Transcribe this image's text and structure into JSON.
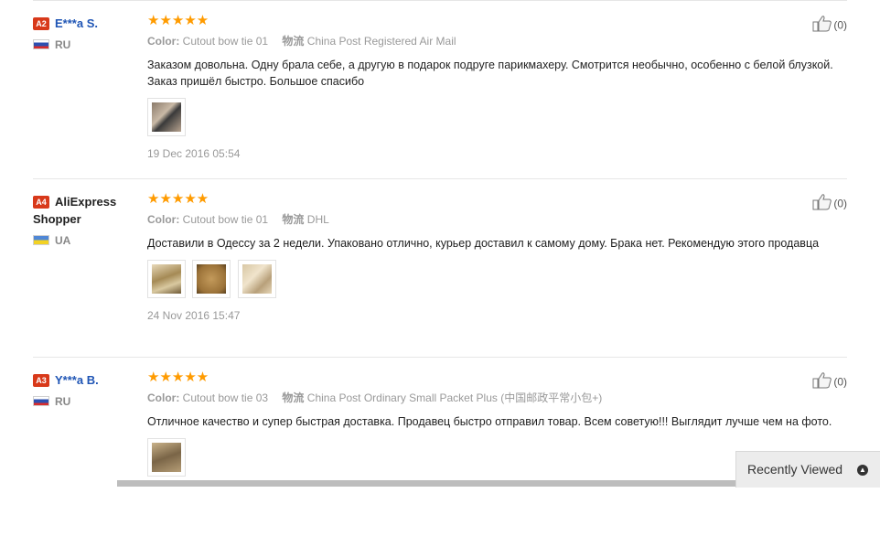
{
  "reviews": [
    {
      "level": "A2",
      "user_lines": [
        "E***a S."
      ],
      "country": "RU",
      "stars": "★★★★★",
      "color_label": "Color:",
      "color_value": "Cutout bow tie 01",
      "shipping_label": "物流",
      "shipping_value": "China Post Registered Air Mail",
      "text": "Заказом довольна. Одну брала себе, а другую в подарок подруге парикмахеру. Смотрится необычно, особенно с белой блузкой. Заказ пришёл быстро. Большое спасибо",
      "date": "19 Dec 2016 05:54",
      "likes": "(0)"
    },
    {
      "level": "A4",
      "user_lines": [
        "AliExpress",
        "Shopper"
      ],
      "country": "UA",
      "stars": "★★★★★",
      "color_label": "Color:",
      "color_value": "Cutout bow tie 01",
      "shipping_label": "物流",
      "shipping_value": "DHL",
      "text": "Доставили в Одессу за 2 недели. Упаковано отлично, курьер доставил к самому дому. Брака нет. Рекомендую этого продавца",
      "date": "24 Nov 2016 15:47",
      "likes": "(0)"
    },
    {
      "level": "A3",
      "user_lines": [
        "Y***a B."
      ],
      "country": "RU",
      "stars": "★★★★★",
      "color_label": "Color:",
      "color_value": "Cutout bow tie 03",
      "shipping_label": "物流",
      "shipping_value": "China Post Ordinary Small Packet Plus (中国邮政平常小包+)",
      "text": "Отличное качество и супер быстрая доставка. Продавец быстро отправил товар. Всем советую!!! Выглядит лучше чем на фото.",
      "likes": "(0)"
    }
  ],
  "recently_viewed": "Recently Viewed",
  "colors": {
    "star": "#ff9b00",
    "username": "#1f55b5",
    "badge": "#d8391a"
  },
  "icons": {
    "like": "thumbs-up-icon",
    "recent": "chevron-up-icon"
  }
}
